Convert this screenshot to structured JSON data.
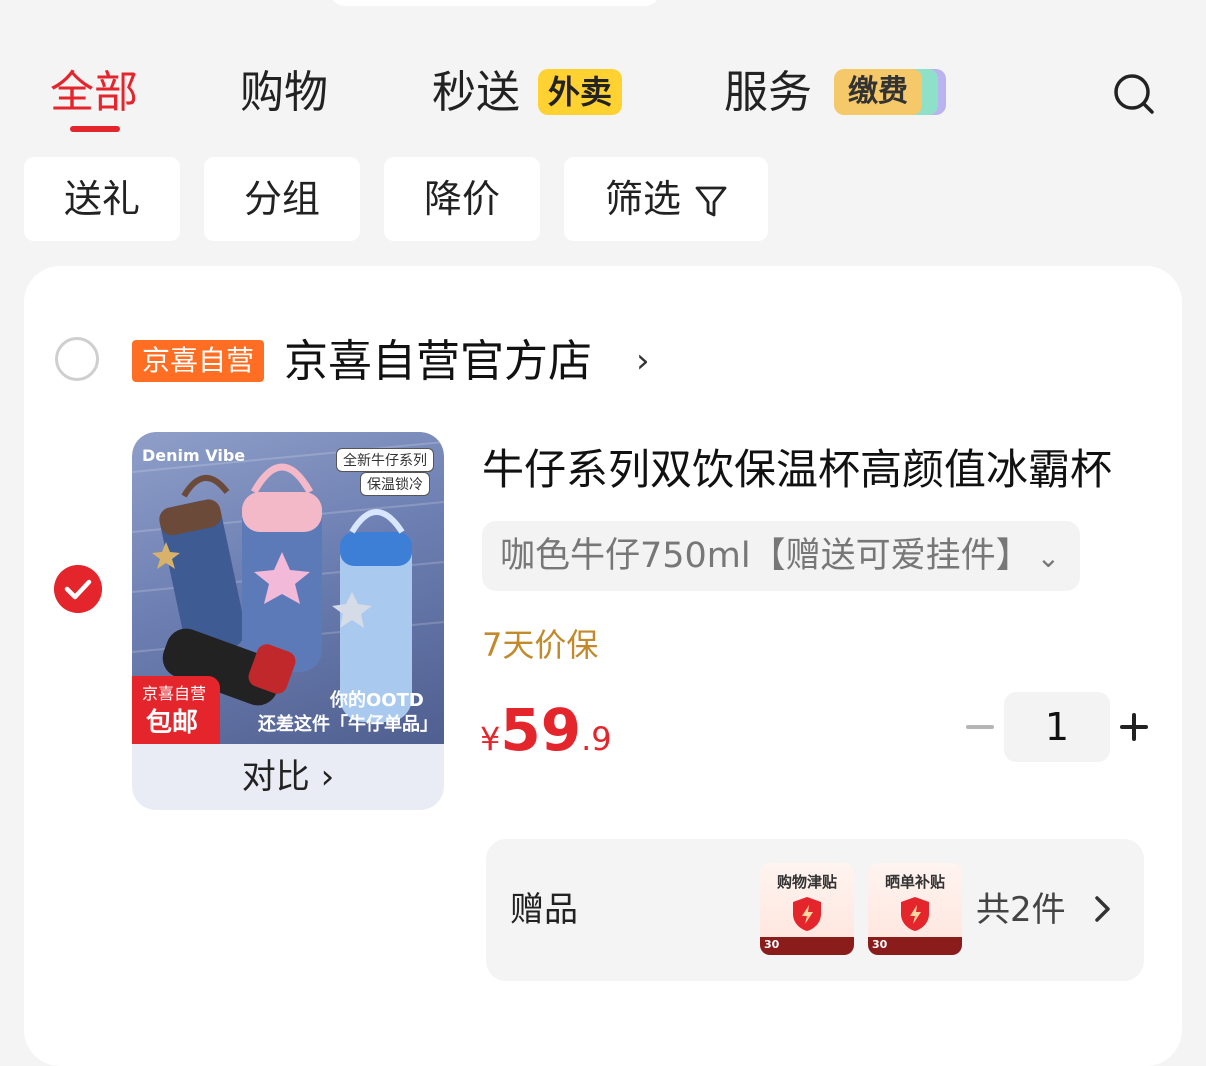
{
  "tabs": {
    "all": "全部",
    "shopping": "购物",
    "express": "秒送",
    "express_badge": "外卖",
    "service": "服务",
    "service_badge": "缴费"
  },
  "filters": {
    "gift": "送礼",
    "group": "分组",
    "price_drop": "降价",
    "filter": "筛选"
  },
  "store": {
    "tag": "京喜自营",
    "name": "京喜自营官方店",
    "chevron": "›"
  },
  "product": {
    "image": {
      "brand": "Denim Vibe",
      "tag_new": "全新牛仔系列",
      "tag_keep": "保温锁冷",
      "red_tag_line1": "京喜自营",
      "red_tag_line2": "包邮",
      "ootd": "你的OOTD",
      "slogan": "还差这件「牛仔单品」"
    },
    "compare_label": "对比 ›",
    "title": "牛仔系列双饮保温杯高颜值冰霸杯",
    "variant": "咖色牛仔750ml【赠送可爱挂件】",
    "variant_chevron": "⌄",
    "price_protect": "7天价保",
    "price": {
      "currency": "¥",
      "integer": "59",
      "decimal": ".9"
    },
    "quantity": "1"
  },
  "gifts": {
    "label": "赠品",
    "items": [
      {
        "title": "购物津贴",
        "badge": "30"
      },
      {
        "title": "晒单补贴",
        "badge": "30"
      }
    ],
    "count": "共2件"
  },
  "colors": {
    "accent_red": "#e4262c",
    "store_tag_orange": "#ff6e22",
    "badge_yellow": "#ffd232",
    "price_protect_gold": "#c28a2a"
  }
}
